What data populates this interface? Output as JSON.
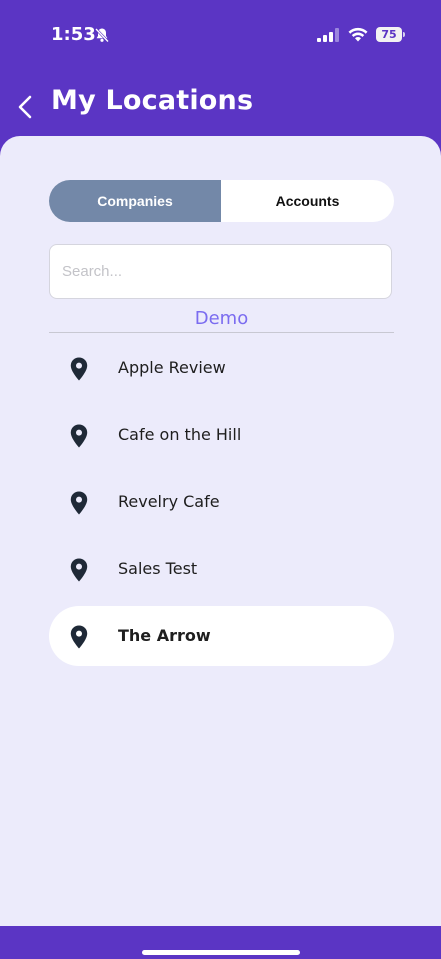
{
  "status_bar": {
    "time": "1:53",
    "battery": "75"
  },
  "header": {
    "title": "My Locations"
  },
  "segment": {
    "companies_label": "Companies",
    "accounts_label": "Accounts",
    "active": "Companies"
  },
  "search": {
    "placeholder": "Search...",
    "value": ""
  },
  "group": {
    "label": "Demo"
  },
  "locations": [
    {
      "label": "Apple Review"
    },
    {
      "label": "Cafe on the Hill"
    },
    {
      "label": "Revelry Cafe"
    },
    {
      "label": "Sales Test"
    },
    {
      "label": "The Arrow"
    }
  ],
  "selected_location": "The Arrow",
  "colors": {
    "brand": "#5b35c4",
    "background": "#ecebfb",
    "segment_active": "#7388a8",
    "group_label": "#7b6cf0",
    "pin": "#1f2937"
  }
}
